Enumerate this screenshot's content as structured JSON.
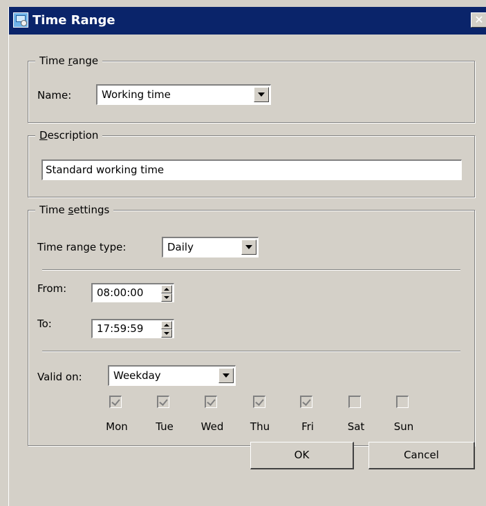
{
  "window": {
    "title": "Time Range",
    "close_glyph": "✕"
  },
  "time_range": {
    "legend_pre": "Time ",
    "legend_ul": "r",
    "legend_post": "ange",
    "name_label": "Name:",
    "name_value": "Working time"
  },
  "description": {
    "legend_ul": "D",
    "legend_post": "escription",
    "value": "Standard working time"
  },
  "time_settings": {
    "legend_pre": "Time ",
    "legend_ul": "s",
    "legend_post": "ettings",
    "type_label": "Time range type:",
    "type_value": "Daily",
    "from_label": "From:",
    "from_value": "08:00:00",
    "to_label": "To:",
    "to_value": "17:59:59",
    "valid_label": "Valid on:",
    "valid_value": "Weekday",
    "days": [
      {
        "label": "Mon",
        "checked": true
      },
      {
        "label": "Tue",
        "checked": true
      },
      {
        "label": "Wed",
        "checked": true
      },
      {
        "label": "Thu",
        "checked": true
      },
      {
        "label": "Fri",
        "checked": true
      },
      {
        "label": "Sat",
        "checked": false
      },
      {
        "label": "Sun",
        "checked": false
      }
    ]
  },
  "buttons": {
    "ok": "OK",
    "cancel": "Cancel"
  }
}
